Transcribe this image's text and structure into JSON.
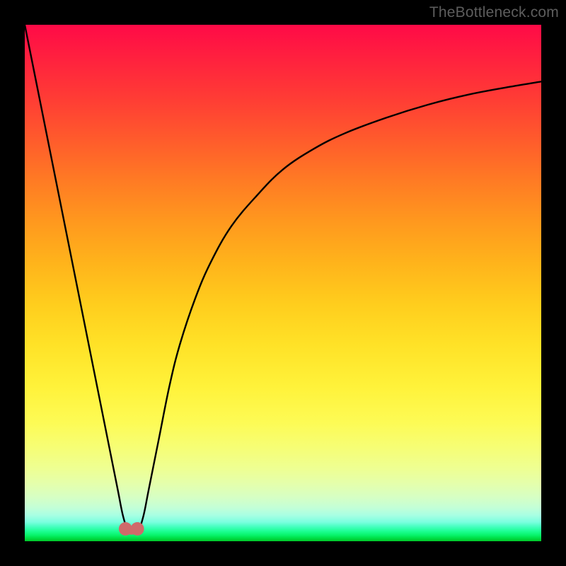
{
  "watermark": "TheBottleneck.com",
  "colors": {
    "page_bg": "#000000",
    "curve": "#000000",
    "marker": "#cf6a6a",
    "gradient_top": "#ff0a47",
    "gradient_bottom": "#00c628"
  },
  "chart_data": {
    "type": "line",
    "title": "",
    "xlabel": "",
    "ylabel": "",
    "xlim": [
      0,
      100
    ],
    "ylim": [
      0,
      100
    ],
    "x": [
      0,
      2,
      4,
      6,
      8,
      10,
      12,
      14,
      16,
      18,
      19,
      20,
      21,
      22,
      23,
      24,
      26,
      28,
      30,
      33,
      36,
      40,
      45,
      50,
      56,
      62,
      70,
      78,
      86,
      94,
      100
    ],
    "values": [
      100,
      90,
      80,
      70,
      60,
      50,
      40,
      30,
      20,
      10,
      5,
      2,
      1.5,
      2,
      5,
      10,
      20,
      30,
      38,
      47,
      54,
      61,
      67,
      72,
      76,
      79,
      82,
      84.5,
      86.5,
      88,
      89
    ],
    "markers": {
      "x": [
        19.5,
        21.8
      ],
      "y": [
        2.4,
        2.4
      ],
      "r": 1.3
    }
  }
}
